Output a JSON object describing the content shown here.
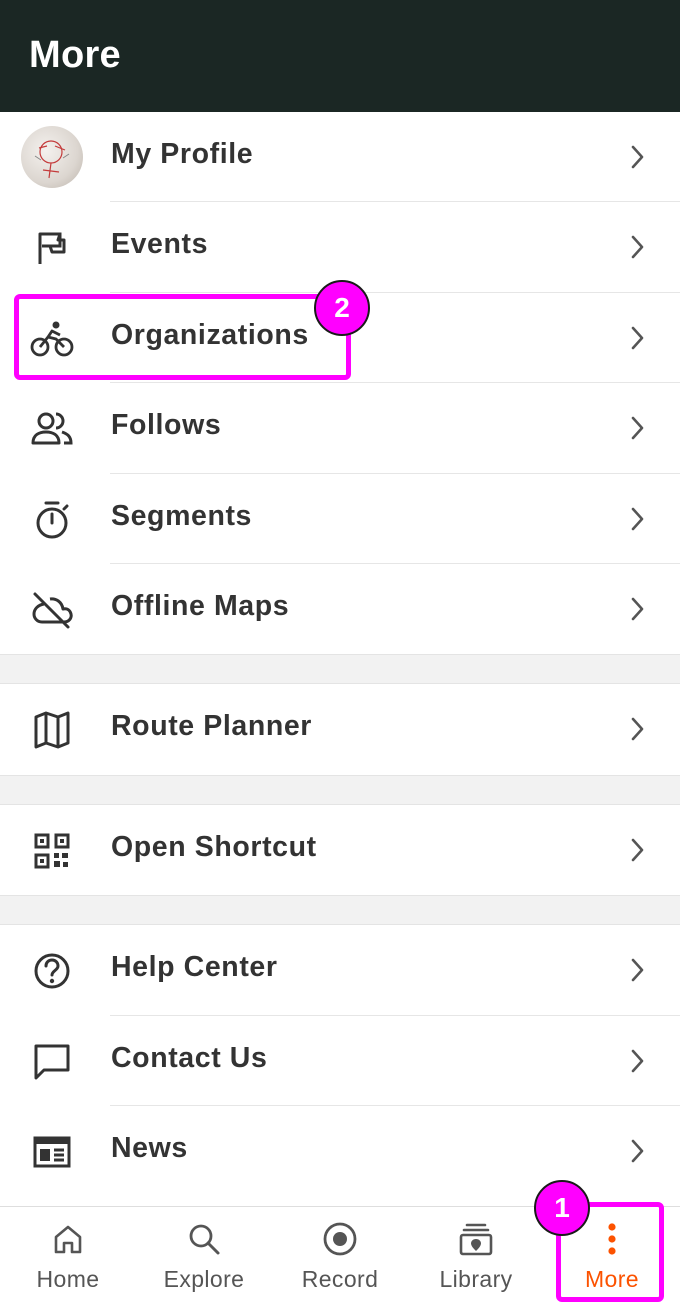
{
  "header": {
    "title": "More"
  },
  "menu": {
    "group1": [
      {
        "label": "My Profile",
        "icon": "avatar"
      },
      {
        "label": "Events",
        "icon": "flag-icon"
      },
      {
        "label": "Organizations",
        "icon": "bicycle-icon"
      },
      {
        "label": "Follows",
        "icon": "people-icon"
      },
      {
        "label": "Segments",
        "icon": "stopwatch-icon"
      },
      {
        "label": "Offline Maps",
        "icon": "cloud-off-icon"
      }
    ],
    "group2": [
      {
        "label": "Route Planner",
        "icon": "map-icon"
      }
    ],
    "group3": [
      {
        "label": "Open Shortcut",
        "icon": "qr-code-icon"
      }
    ],
    "group4": [
      {
        "label": "Help Center",
        "icon": "help-circle-icon"
      },
      {
        "label": "Contact Us",
        "icon": "chat-bubble-icon"
      },
      {
        "label": "News",
        "icon": "newspaper-icon"
      }
    ]
  },
  "bottom_nav": [
    {
      "label": "Home",
      "icon": "home-icon"
    },
    {
      "label": "Explore",
      "icon": "search-icon"
    },
    {
      "label": "Record",
      "icon": "record-icon"
    },
    {
      "label": "Library",
      "icon": "library-icon"
    },
    {
      "label": "More",
      "icon": "more-vertical-icon",
      "active": true
    }
  ],
  "annotations": {
    "badge1": "1",
    "badge2": "2"
  },
  "colors": {
    "topbar": "#1b2724",
    "accent": "#fc5200",
    "highlight": "#ff00ff"
  }
}
